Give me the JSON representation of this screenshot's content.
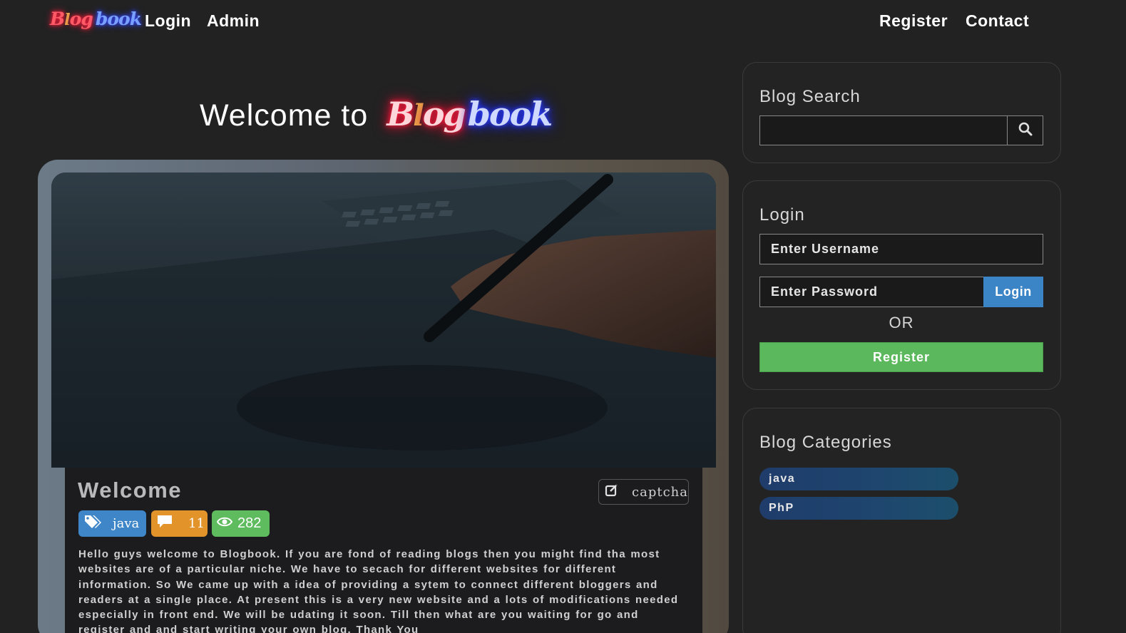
{
  "navbar": {
    "logo_text": {
      "b": "B",
      "l": "l",
      "og": "og",
      "book": "book"
    },
    "links_left": [
      "Login",
      "Admin"
    ],
    "links_right": [
      "Register",
      "Contact"
    ]
  },
  "hero": {
    "welcome_text": "Welcome to",
    "logo_text": {
      "b": "B",
      "l": "l",
      "og": "og",
      "book": "book"
    }
  },
  "post": {
    "title": "Welcome",
    "captcha_label": "captcha",
    "tag_label": "java",
    "comment_count": "11",
    "view_count": "282",
    "body": "Hello guys welcome to Blogbook. If you are fond of reading blogs then you might find tha most websites are of a particular niche. We have to secach for different websites for different information. So We came up with a idea of providing a sytem to connect different bloggers and readers at a single place.   At present this is a very new website and a lots of modifications needed especially in front end. We will be udating it soon. Till then what are you waiting for go and register and and start writing your own blog.    Thank You"
  },
  "sidebar": {
    "search": {
      "heading": "Blog Search",
      "placeholder": "",
      "icon": "search-icon"
    },
    "login": {
      "heading": "Login",
      "username_placeholder": "Enter Username",
      "password_placeholder": "Enter Password",
      "login_label": "Login",
      "or_text": "OR",
      "register_label": "Register"
    },
    "categories": {
      "heading": "Blog Categories",
      "items": [
        "java",
        "PhP"
      ]
    }
  },
  "colors": {
    "background": "#222223",
    "primary_blue": "#3b84c6",
    "success_green": "#5cb85c",
    "warning_orange": "#e2942b",
    "neon_red": "#ff1c3c",
    "neon_blue": "#3346ff"
  }
}
